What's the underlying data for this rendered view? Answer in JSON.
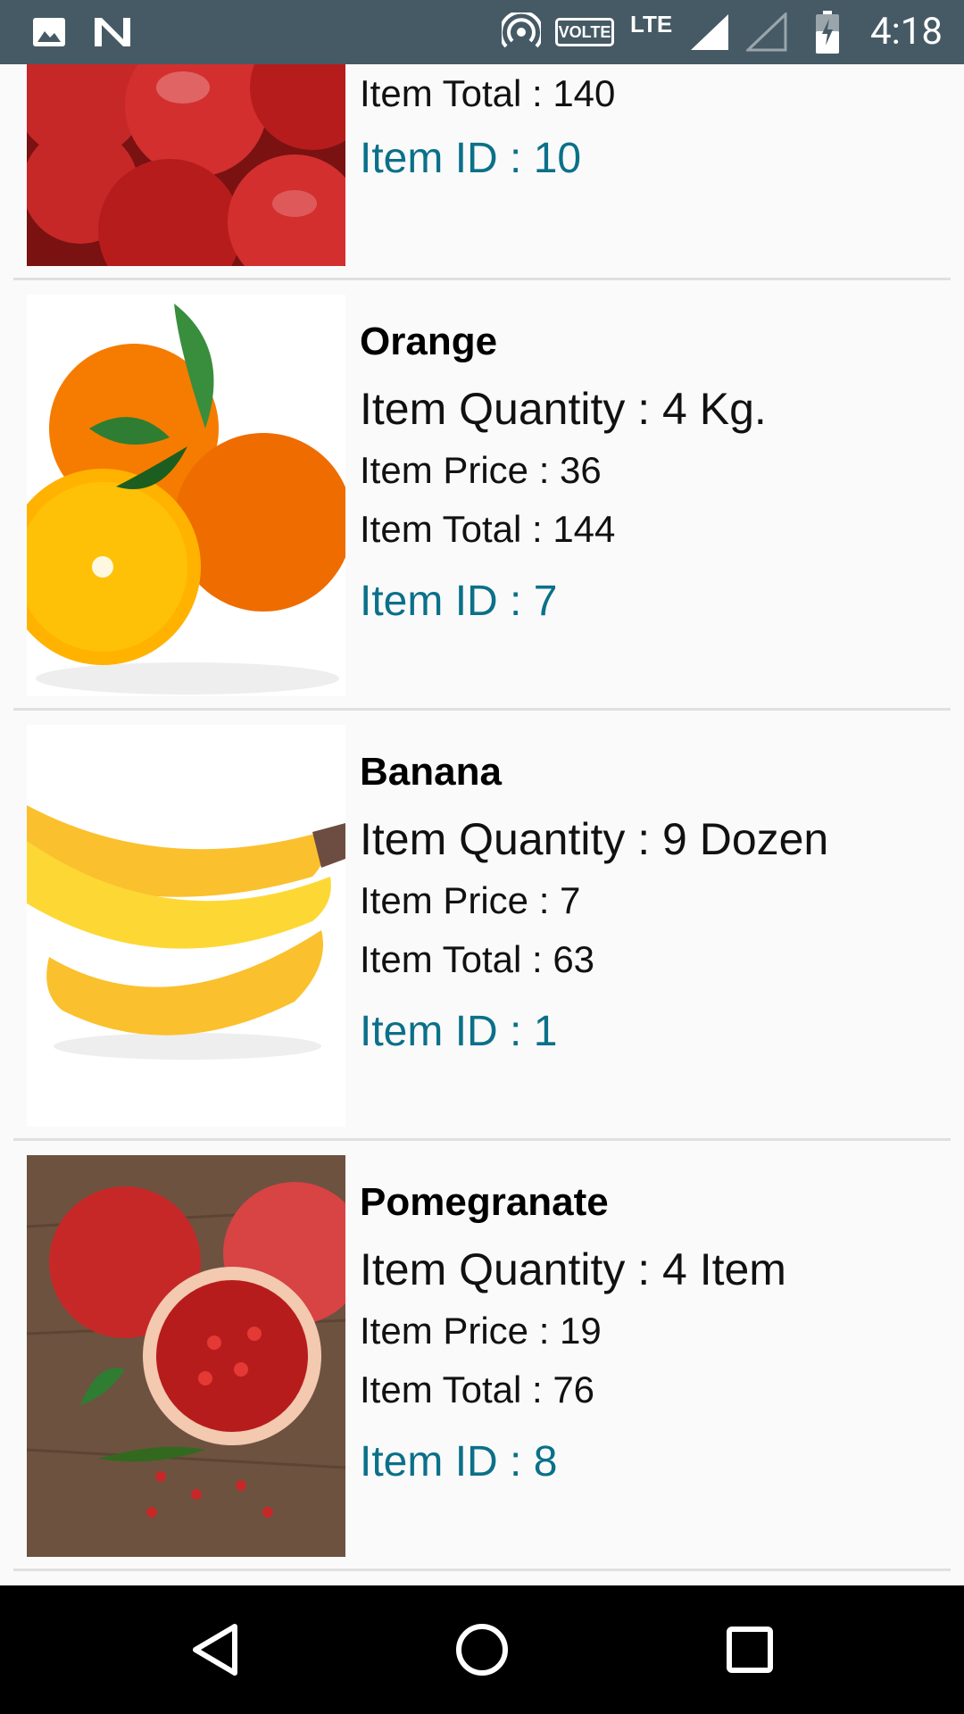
{
  "status_bar": {
    "time": "4:18",
    "network_label": "LTE",
    "volte_label": "VOLTE",
    "icons": [
      "image-icon",
      "n-icon",
      "hotspot-icon",
      "volte-icon",
      "signal-icon",
      "signal-empty-icon",
      "battery-icon"
    ]
  },
  "items": [
    {
      "name": "",
      "quantity": "",
      "price": "",
      "total": "Item Total : 140",
      "id": "Item ID : 10",
      "image": "apple-image"
    },
    {
      "name": "Orange",
      "quantity": "Item Quantity : 4 Kg.",
      "price": "Item Price : 36",
      "total": "Item Total : 144",
      "id": "Item ID : 7",
      "image": "orange-image"
    },
    {
      "name": "Banana",
      "quantity": "Item Quantity : 9 Dozen",
      "price": "Item Price : 7",
      "total": "Item Total : 63",
      "id": "Item ID : 1",
      "image": "banana-image"
    },
    {
      "name": "Pomegranate",
      "quantity": "Item Quantity : 4 Item",
      "price": "Item Price : 19",
      "total": "Item Total : 76",
      "id": "Item ID : 8",
      "image": "pomegranate-image"
    }
  ],
  "nav_bar": {
    "buttons": [
      "back-icon",
      "home-icon",
      "recents-icon"
    ]
  },
  "colors": {
    "status_bar_bg": "#455a64",
    "id_text": "#0b7089",
    "background": "#fafafa",
    "nav_bar_bg": "#000000"
  }
}
